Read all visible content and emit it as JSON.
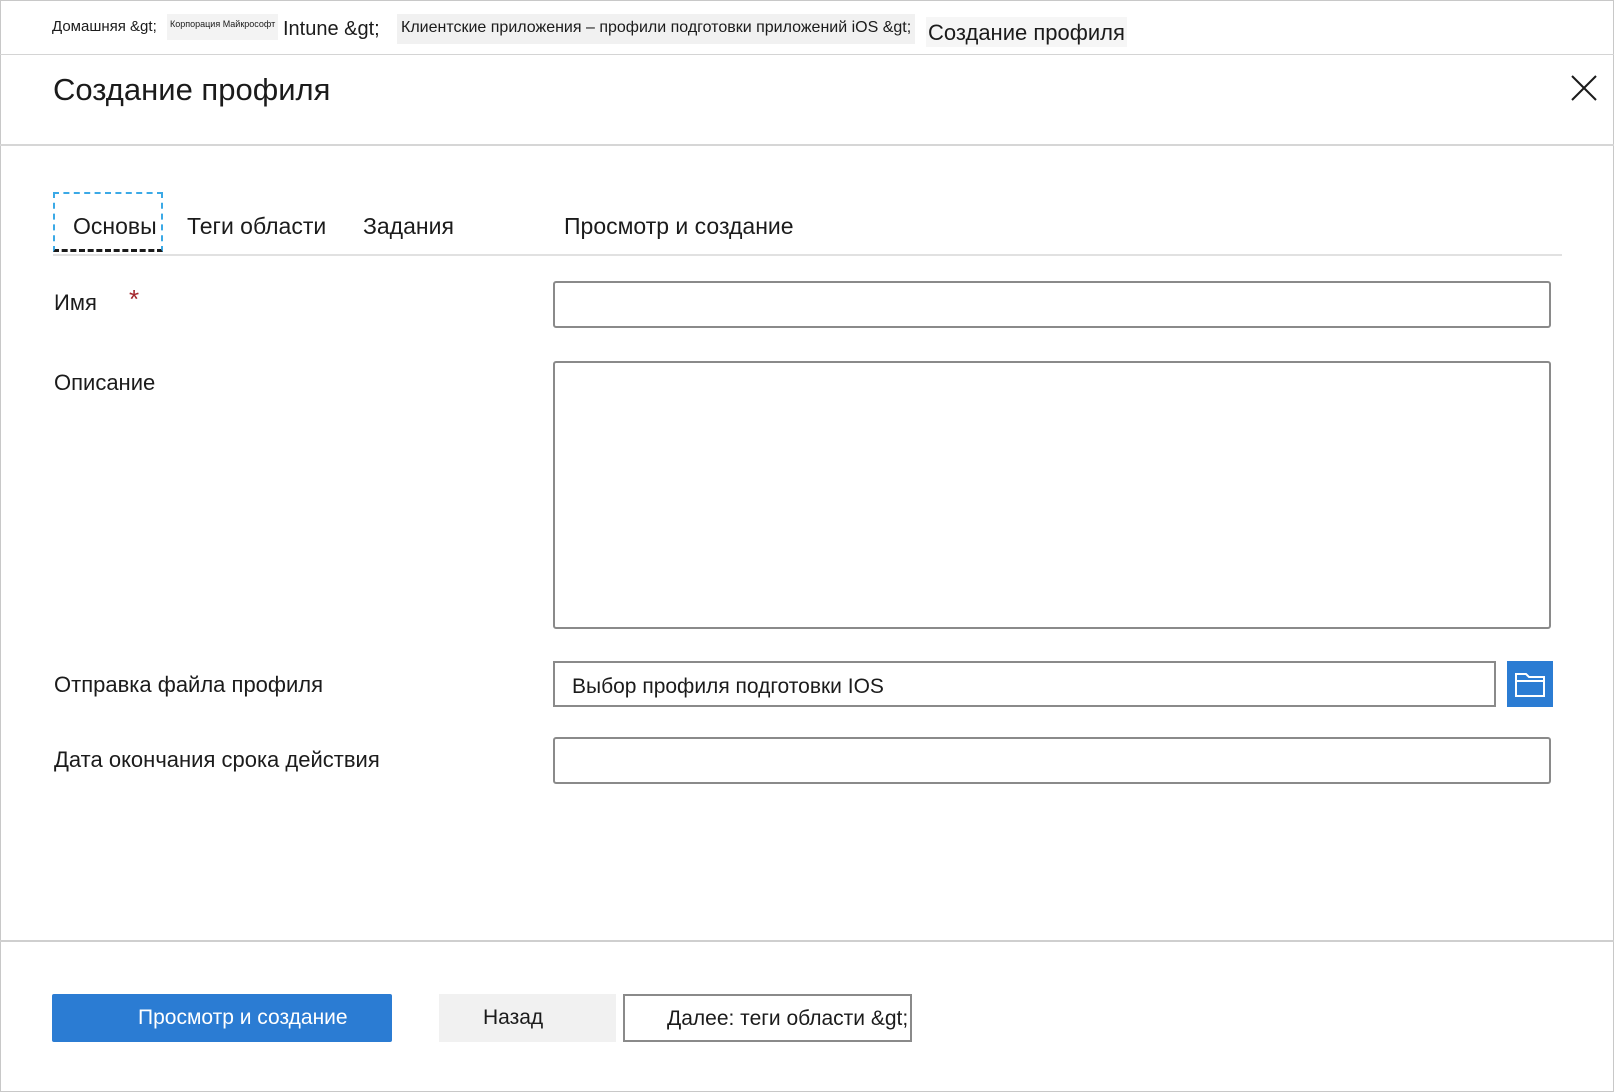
{
  "breadcrumb": {
    "home": "Домашняя &gt;",
    "corp": "Корпорация Майкрософт",
    "intune": "Intune &gt;",
    "apps": "Клиентские приложения – профили подготовки приложений iOS &gt;",
    "current": "Создание профиля"
  },
  "header": {
    "title": "Создание профиля",
    "close_icon": "close-icon"
  },
  "tabs": [
    {
      "label": "Основы",
      "active": true
    },
    {
      "label": "Теги области",
      "active": false
    },
    {
      "label": "Задания",
      "active": false
    },
    {
      "label": "Просмотр и создание",
      "active": false
    }
  ],
  "form": {
    "name_label": "Имя",
    "required_marker": "*",
    "name_value": "",
    "description_label": "Описание",
    "description_value": "",
    "upload_label": "Отправка файла профиля",
    "upload_placeholder": "Выбор профиля подготовки IOS",
    "upload_icon": "folder-icon",
    "expiry_label": "Дата окончания срока действия",
    "expiry_value": ""
  },
  "footer": {
    "review_create": "Просмотр и создание",
    "back": "Назад",
    "next": "Далее: теги области &gt;"
  },
  "colors": {
    "accent": "#2b7cd3",
    "required": "#a4262c",
    "focus_outline": "#3ba9e6"
  }
}
